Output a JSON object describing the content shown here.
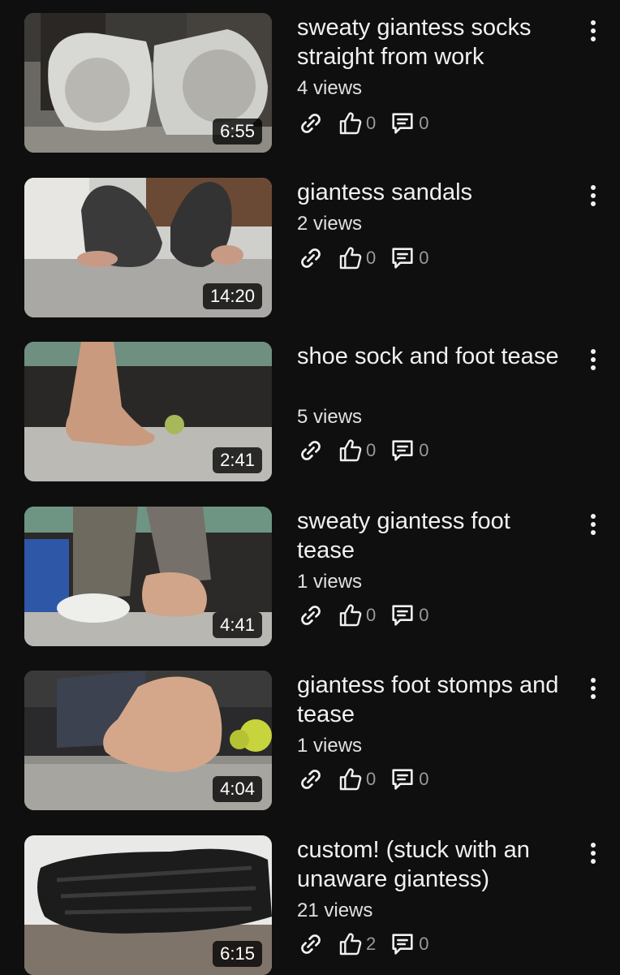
{
  "videos": [
    {
      "title": "sweaty giantess socks straight from work",
      "views": "4 views",
      "duration": "6:55",
      "likes": "0",
      "comments": "0"
    },
    {
      "title": "giantess sandals",
      "views": "2 views",
      "duration": "14:20",
      "likes": "0",
      "comments": "0"
    },
    {
      "title": "shoe sock and foot tease",
      "views": "5 views",
      "duration": "2:41",
      "likes": "0",
      "comments": "0"
    },
    {
      "title": "sweaty giantess foot tease",
      "views": "1 views",
      "duration": "4:41",
      "likes": "0",
      "comments": "0"
    },
    {
      "title": "giantess foot stomps and tease",
      "views": "1 views",
      "duration": "4:04",
      "likes": "0",
      "comments": "0"
    },
    {
      "title": "custom! (stuck with an unaware giantess)",
      "views": "21 views",
      "duration": "6:15",
      "likes": "2",
      "comments": "0"
    }
  ],
  "icons": {
    "share": "link-icon",
    "like": "thumbs-up-icon",
    "comment": "comment-icon",
    "more": "more-vertical-icon"
  },
  "colors": {
    "background": "#0f0f0f",
    "text": "#f1f1f1",
    "muted": "#9a9a9a"
  }
}
